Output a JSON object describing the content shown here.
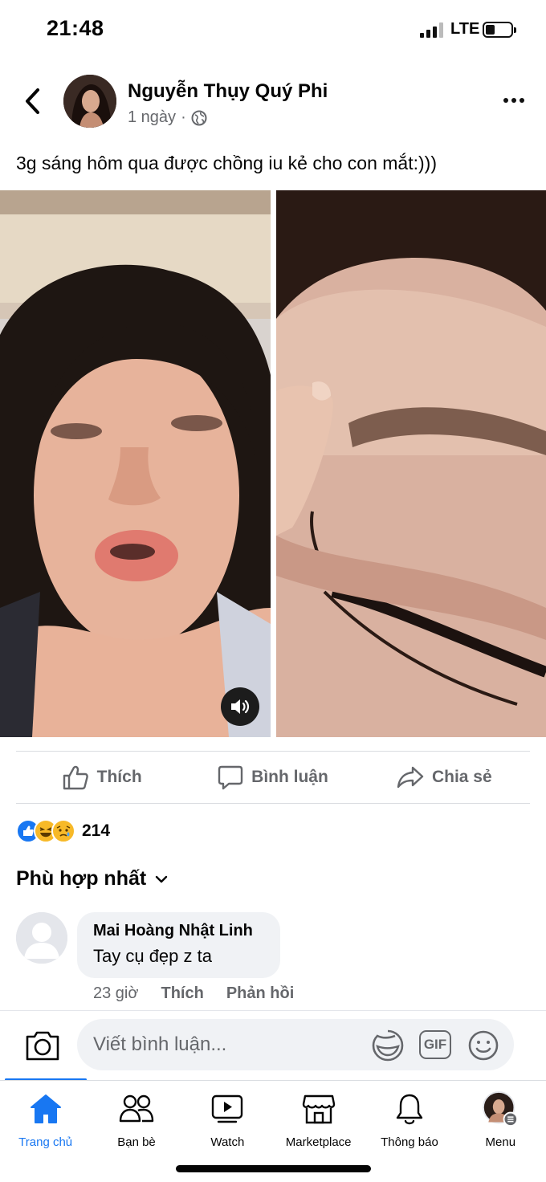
{
  "status_bar": {
    "time": "21:48",
    "network": "LTE"
  },
  "post": {
    "author": "Nguyễn Thụy Quý Phi",
    "time": "1 ngày",
    "separator": "·",
    "text": "3g sáng hôm qua được chồng iu kẻ cho con mắt:)))"
  },
  "actions": {
    "like": "Thích",
    "comment": "Bình luận",
    "share": "Chia sẻ"
  },
  "reactions": {
    "types": [
      "like-icon",
      "laugh-icon",
      "sad-icon"
    ],
    "count": "214"
  },
  "sort": {
    "label": "Phù hợp nhất"
  },
  "comment": {
    "author": "Mai Hoàng Nhật Linh",
    "text": "Tay cụ đẹp z ta",
    "time": "23 giờ",
    "like": "Thích",
    "reply": "Phản hồi"
  },
  "composer": {
    "placeholder": "Viết bình luận...",
    "gif": "GIF"
  },
  "tabs": [
    {
      "label": "Trang chủ",
      "icon": "home-icon",
      "active": true
    },
    {
      "label": "Bạn bè",
      "icon": "friends-icon"
    },
    {
      "label": "Watch",
      "icon": "watch-icon"
    },
    {
      "label": "Marketplace",
      "icon": "marketplace-icon"
    },
    {
      "label": "Thông báo",
      "icon": "bell-icon"
    },
    {
      "label": "Menu",
      "icon": "menu-avatar-icon"
    }
  ],
  "colors": {
    "accent": "#1877f2",
    "secondary_text": "#65676b",
    "bubble": "#f0f2f5"
  }
}
